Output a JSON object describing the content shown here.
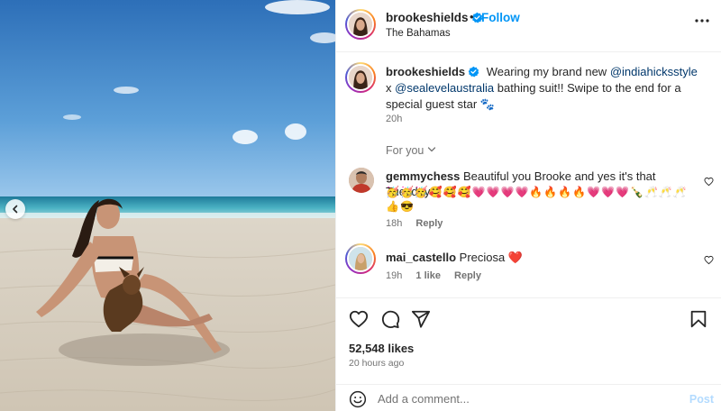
{
  "post": {
    "username": "brookeshields",
    "follow_label": "Follow",
    "location": "The Bahamas",
    "caption_user": "brookeshields",
    "caption_pre": "Wearing my brand new ",
    "mention_1": "@indiahicksstyle",
    "caption_mid": " x ",
    "mention_2": "@sealevelaustralia",
    "caption_post": " bathing suit!! Swipe to the end for a special guest star 🐾",
    "caption_time": "20h",
    "likes": "52,548 likes",
    "time_ago": "20 hours ago"
  },
  "comments": {
    "filter_label": "For you",
    "items": [
      {
        "user": "gemmychess",
        "text": "Beautiful you Brooke and yes it's that Tuesday",
        "emojis": "🥳🥳🥳🥰🥰🥰💗💗💗💗🔥🔥🔥🔥💗💗💗🍾🥂🥂🥂👍😎",
        "time": "18h",
        "reply_label": "Reply"
      },
      {
        "user": "mai_castello",
        "text": "Preciosa ",
        "heart": "❤️",
        "time": "19h",
        "likes_label": "1 like",
        "reply_label": "Reply"
      }
    ]
  },
  "composer": {
    "placeholder": "Add a comment...",
    "post_label": "Post"
  },
  "icons": {
    "verified": "verified-badge-icon",
    "more": "more-options-icon",
    "like": "heart-icon",
    "comment": "comment-bubble-icon",
    "share": "paper-plane-icon",
    "save": "bookmark-icon",
    "emoji": "smiley-icon",
    "prev": "chevron-left-icon",
    "dropdown": "chevron-down-icon"
  },
  "colors": {
    "accent": "#0095f6",
    "mention": "#00376b",
    "secondary_text": "#737373",
    "post_disabled": "#b3dbff"
  }
}
